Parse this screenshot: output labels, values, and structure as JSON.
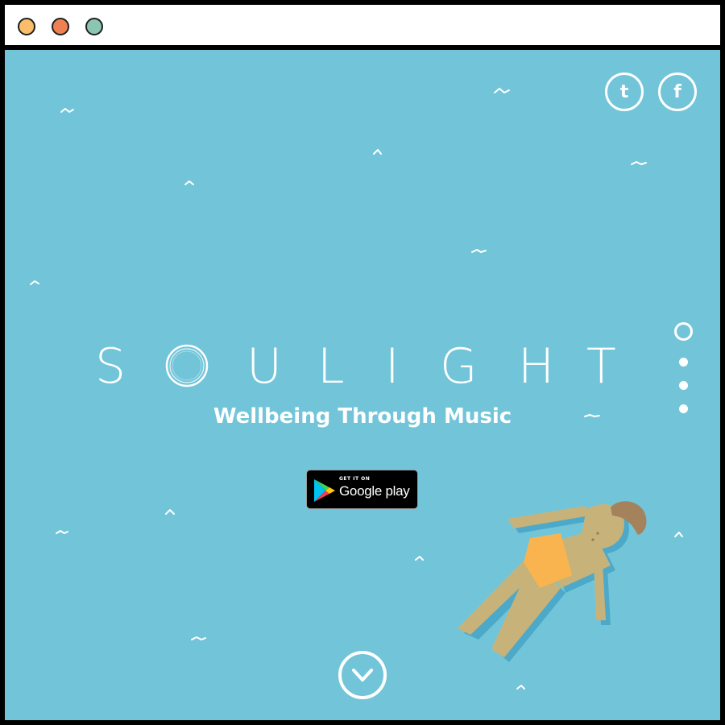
{
  "window": {
    "buttons": [
      {
        "name": "close",
        "color": "#f9bd6b"
      },
      {
        "name": "minimize",
        "color": "#ee8051"
      },
      {
        "name": "maximize",
        "color": "#8ac6b0"
      }
    ]
  },
  "theme": {
    "background": "#72c5d9",
    "foreground": "#ffffff"
  },
  "social": {
    "tumblr_label": "t",
    "facebook_label": "f"
  },
  "hero": {
    "logo_letters": [
      "S",
      "O",
      "U",
      "L",
      "I",
      "G",
      "H",
      "T"
    ],
    "tagline": "Wellbeing Through Music"
  },
  "store_badge": {
    "small_text": "GET IT ON",
    "big_text": "Google play"
  },
  "pager": {
    "total": 4,
    "active_index": 0
  },
  "icons": {
    "scroll": "chevron-down-icon",
    "play_store": "google-play-icon"
  }
}
